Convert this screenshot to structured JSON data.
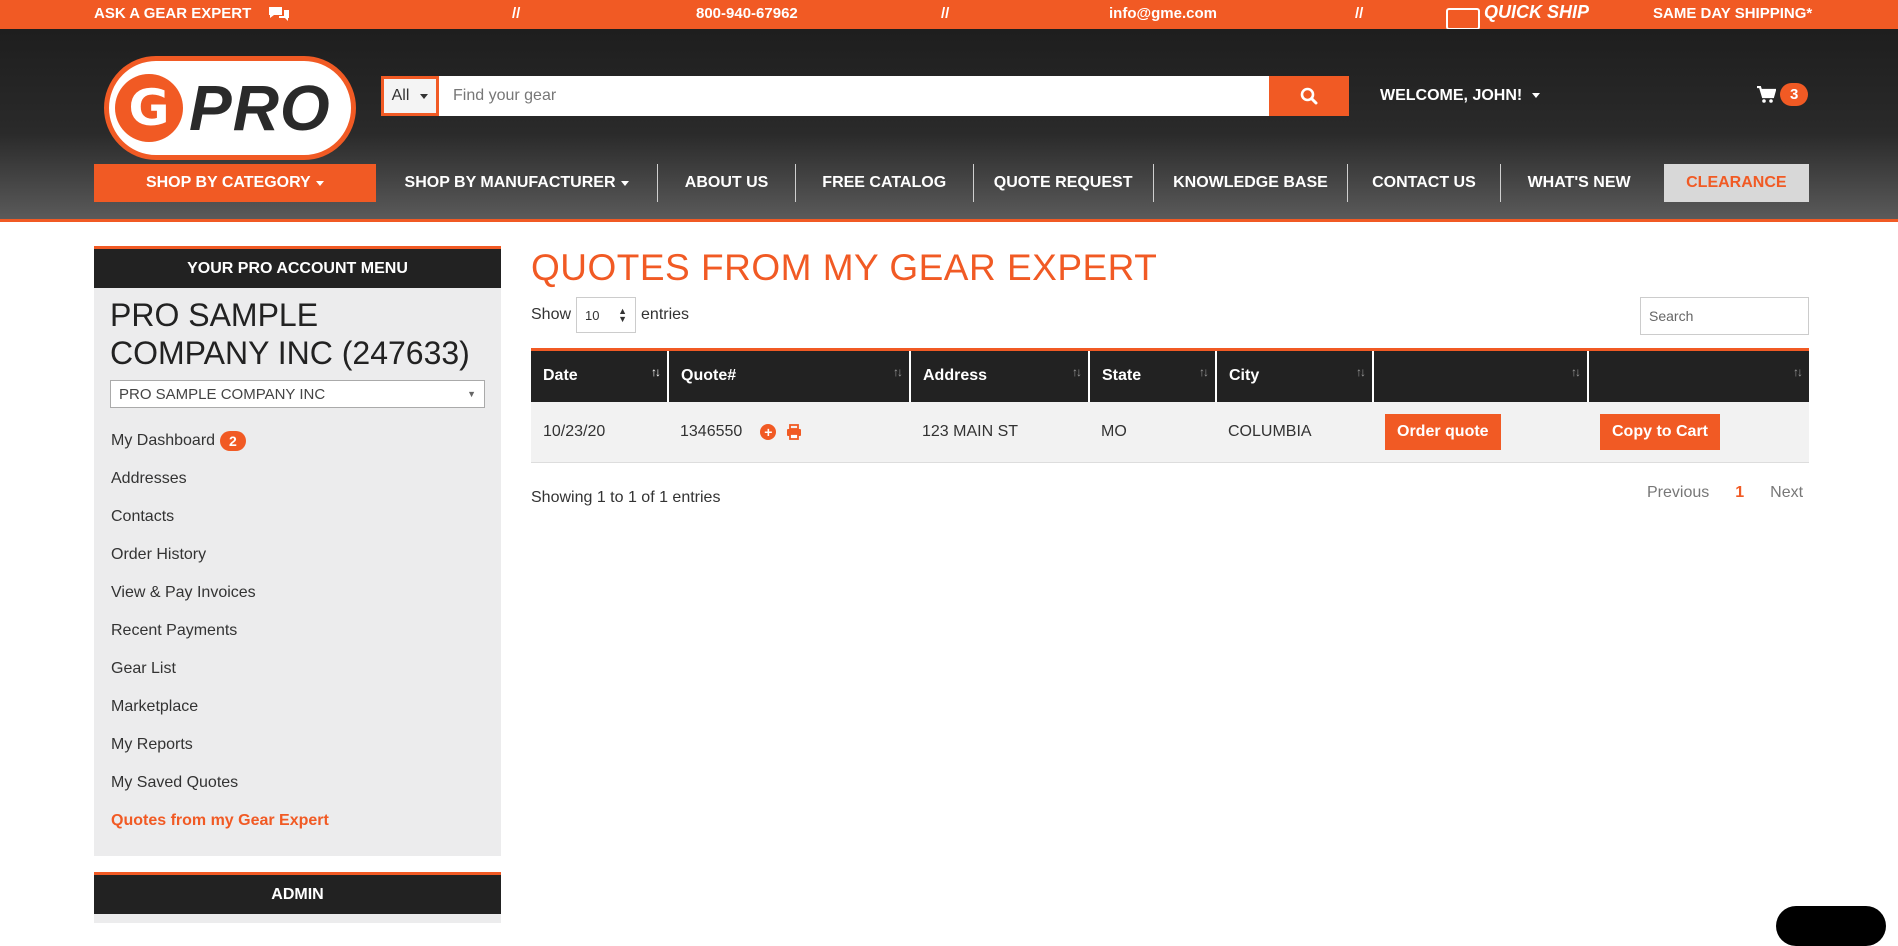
{
  "topbar": {
    "ask_expert": "ASK A GEAR EXPERT",
    "sep1": "//",
    "phone": "800-940-67962",
    "sep2": "//",
    "email": "info@gme.com",
    "sep3": "//",
    "quick_ship": "QUICK SHIP",
    "same_day": "SAME DAY SHIPPING*"
  },
  "logo": {
    "text": "PRO",
    "mark": "G"
  },
  "search": {
    "category": "All",
    "placeholder": "Find your gear"
  },
  "account": {
    "welcome": "WELCOME, JOHN!"
  },
  "cart": {
    "count": "3"
  },
  "nav": {
    "items": [
      "SHOP BY CATEGORY",
      "SHOP BY MANUFACTURER",
      "ABOUT US",
      "FREE CATALOG",
      "QUOTE REQUEST",
      "KNOWLEDGE BASE",
      "CONTACT US",
      "WHAT'S NEW",
      "CLEARANCE"
    ]
  },
  "sidebar": {
    "heading": "YOUR PRO ACCOUNT MENU",
    "company": "PRO SAMPLE COMPANY INC (247633)",
    "company_select": "PRO SAMPLE COMPANY INC",
    "dashboard_badge": "2",
    "links": [
      "My Dashboard",
      "Addresses",
      "Contacts",
      "Order History",
      "View & Pay Invoices",
      "Recent Payments",
      "Gear List",
      "Marketplace",
      "My Reports",
      "My Saved Quotes",
      "Quotes from my Gear Expert"
    ],
    "admin_heading": "ADMIN"
  },
  "main": {
    "title": "QUOTES FROM MY GEAR EXPERT",
    "show_label": "Show",
    "show_value": "10",
    "entries_label": "entries",
    "search_placeholder": "Search",
    "columns": [
      "Date",
      "Quote#",
      "Address",
      "State",
      "City",
      "",
      ""
    ],
    "rows": [
      {
        "date": "10/23/20",
        "quote": "1346550",
        "address": "123 MAIN ST",
        "state": "MO",
        "city": "COLUMBIA",
        "order_btn": "Order quote",
        "copy_btn": "Copy to Cart"
      }
    ],
    "showing": "Showing 1 to 1 of 1 entries",
    "pager": {
      "prev": "Previous",
      "current": "1",
      "next": "Next"
    }
  },
  "colors": {
    "accent": "#f15a24",
    "dark": "#222222",
    "sidebar_bg": "#ececed"
  }
}
